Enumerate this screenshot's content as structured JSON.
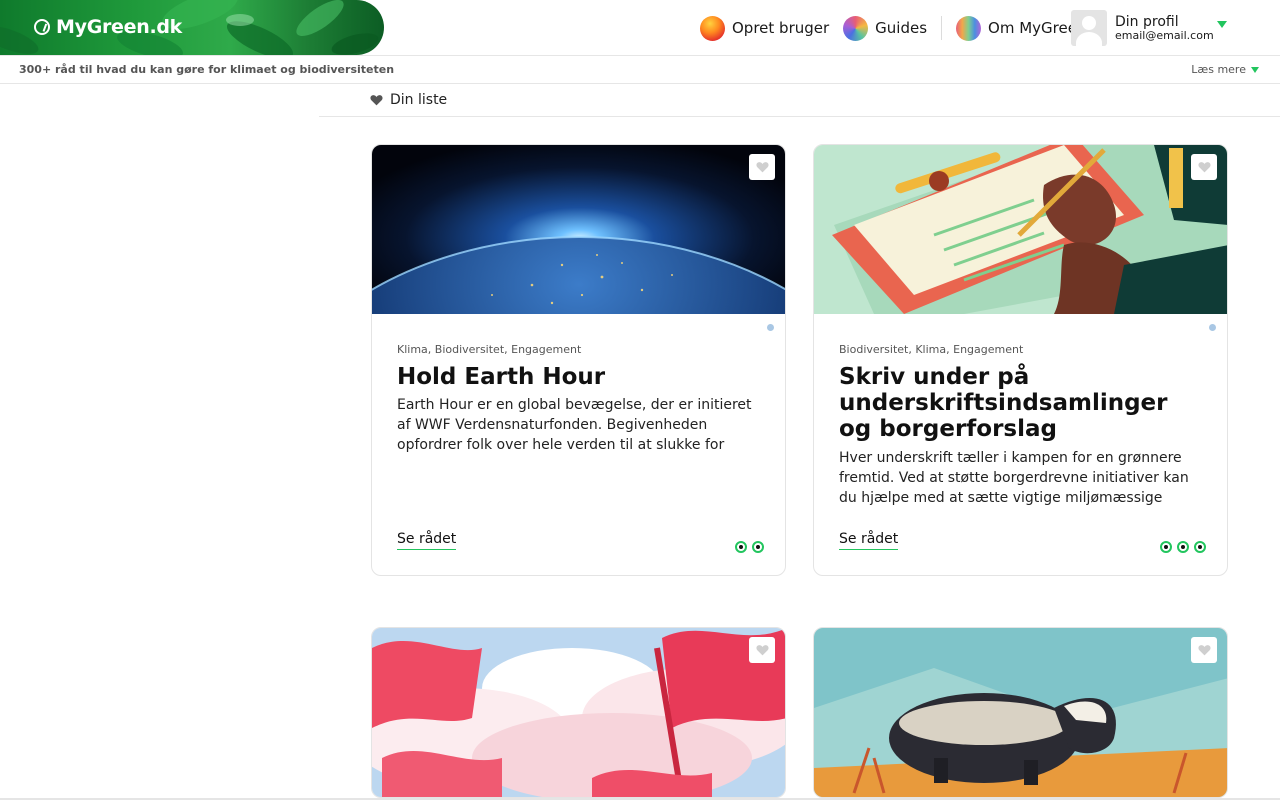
{
  "brand": {
    "name": "MyGreen.dk"
  },
  "nav": {
    "items": [
      {
        "label": "Opret bruger",
        "icon": "orb-orange-icon"
      },
      {
        "label": "Guides",
        "icon": "orb-mosaic-icon"
      },
      {
        "label": "Om MyGreen",
        "icon": "orb-rainbow-icon"
      }
    ],
    "profile": {
      "name": "Din profil",
      "email": "email@email.com"
    }
  },
  "subbar": {
    "tagline": "300+ råd til hvad du kan gøre for klimaet og biodiversiteten",
    "read_more": "Læs mere"
  },
  "list": {
    "label": "Din liste"
  },
  "cards": [
    {
      "categories": "Klima, Biodiversitet, Engagement",
      "title": "Hold Earth Hour",
      "description": "Earth Hour er en global bevægelse, der er initieret af WWF Verdensnaturfonden. Begivenheden opfordrer folk over hele verden til at slukke for lyset i en time én…",
      "link": "Se rådet",
      "dot_count": 2
    },
    {
      "categories": "Biodiversitet, Klima, Engagement",
      "title": "Skriv under på underskriftsindsamlinger og borgerforslag",
      "description": "Hver underskrift tæller i kampen for en grønnere fremtid. Ved at støtte borgerdrevne initiativer kan du hjælpe med at sætte vigtige miljømæssige emner på…",
      "link": "Se rådet",
      "dot_count": 3
    }
  ],
  "colors": {
    "accent": "#22c55e",
    "brand_green": "#1f9a3b",
    "dot_blue": "#a9c7e4"
  }
}
